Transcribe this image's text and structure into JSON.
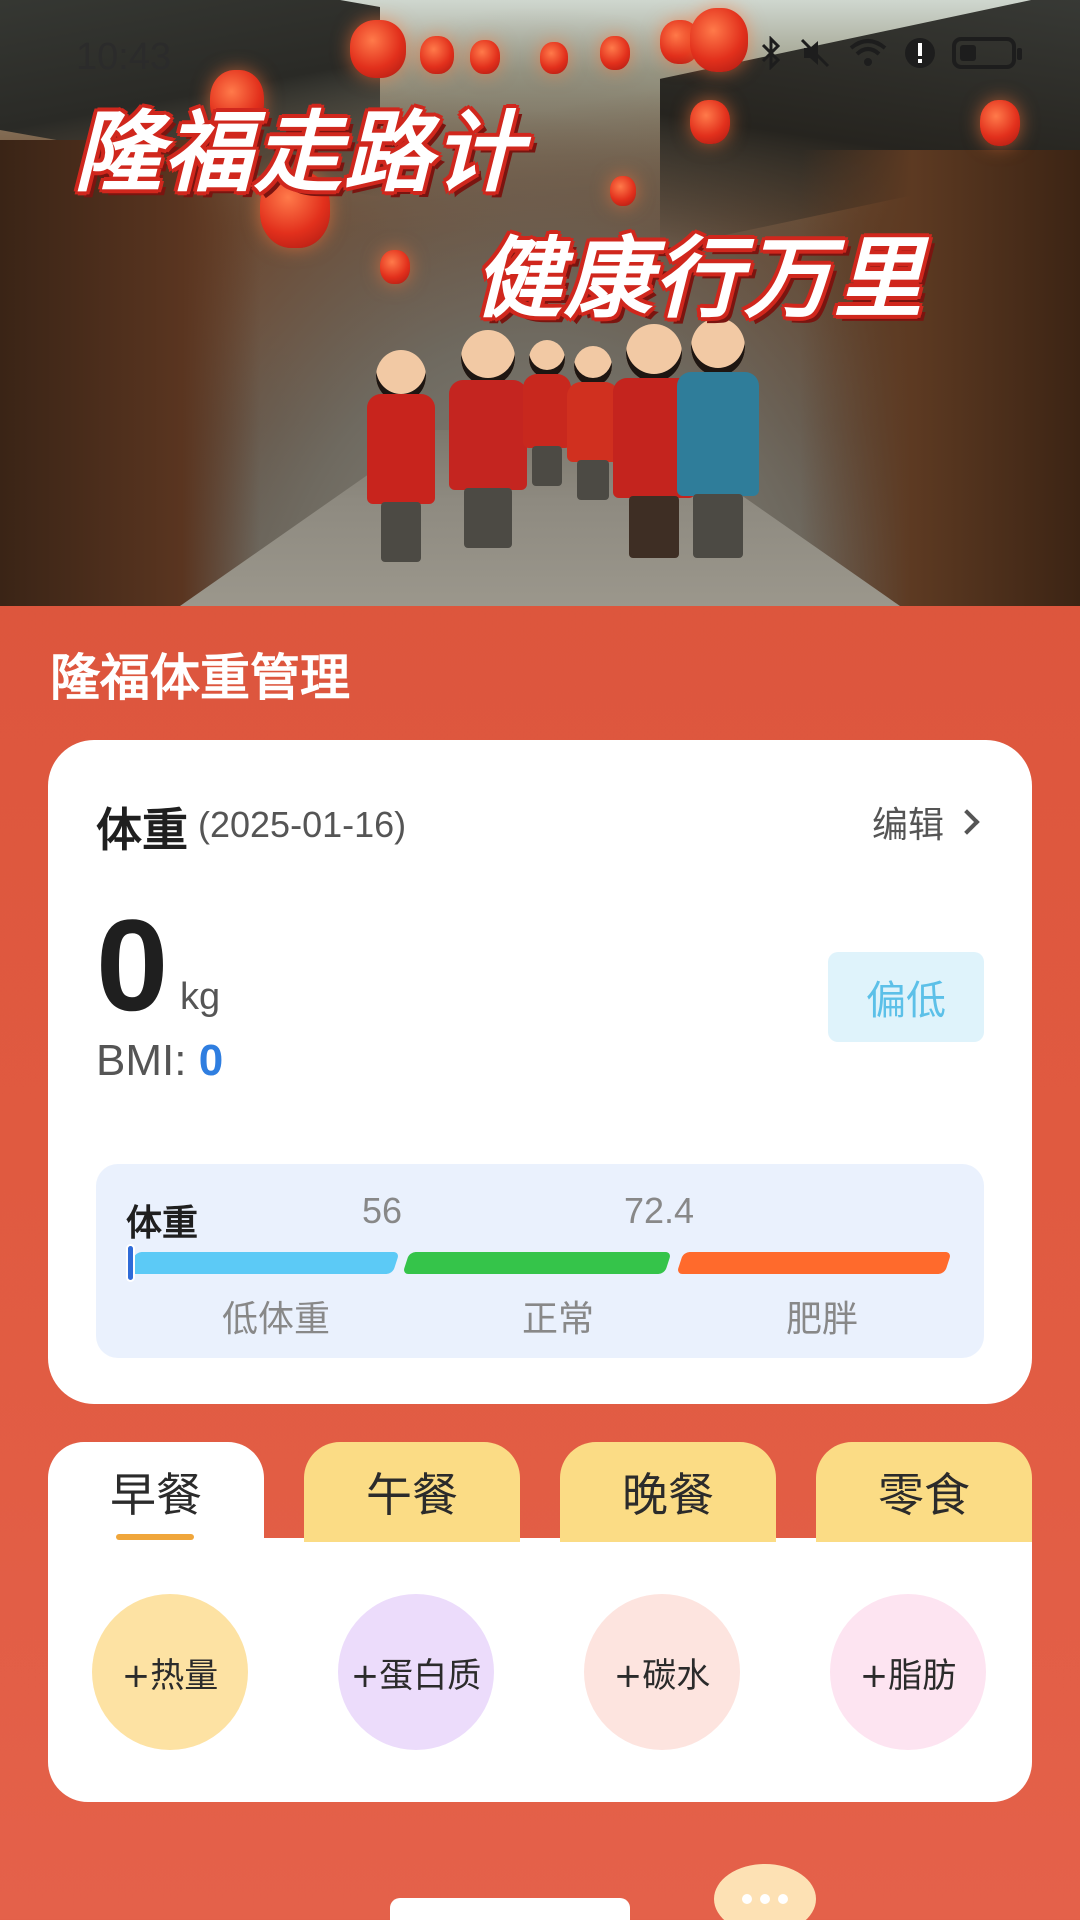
{
  "status_bar": {
    "time": "10:43"
  },
  "banner": {
    "title_line1": "隆福走路计",
    "title_line2": "健康行万里"
  },
  "section": {
    "title": "隆福体重管理"
  },
  "weight_card": {
    "title": "体重",
    "date": "(2025-01-16)",
    "edit_label": "编辑",
    "weight_value": "0",
    "weight_unit": "kg",
    "bmi_label": "BMI:",
    "bmi_value": "0",
    "status_badge": "偏低",
    "scale": {
      "label": "体重",
      "tick_1": "56",
      "tick_2": "72.4",
      "segments": [
        "低体重",
        "正常",
        "肥胖"
      ],
      "marker_value": 0
    }
  },
  "meals": {
    "tabs": [
      "早餐",
      "午餐",
      "晚餐",
      "零食"
    ],
    "active_tab": "早餐",
    "nutrients": [
      {
        "label": "+热量",
        "color": "#fde2a3"
      },
      {
        "label": "+蛋白质",
        "color": "#ecdcfb"
      },
      {
        "label": "+碳水",
        "color": "#fde4df"
      },
      {
        "label": "+脂肪",
        "color": "#fde4f1"
      }
    ]
  },
  "colors": {
    "background": "#dd553c",
    "accent_red": "#d0271d",
    "bmi_blue": "#2f7ee0",
    "badge_text": "#5cc0e8",
    "segment_low": "#5ccaf6",
    "segment_normal": "#35c44a",
    "segment_fat": "#ff6a2c",
    "tab_inactive": "#fbdc85",
    "tab_underline": "#f0a63b"
  }
}
